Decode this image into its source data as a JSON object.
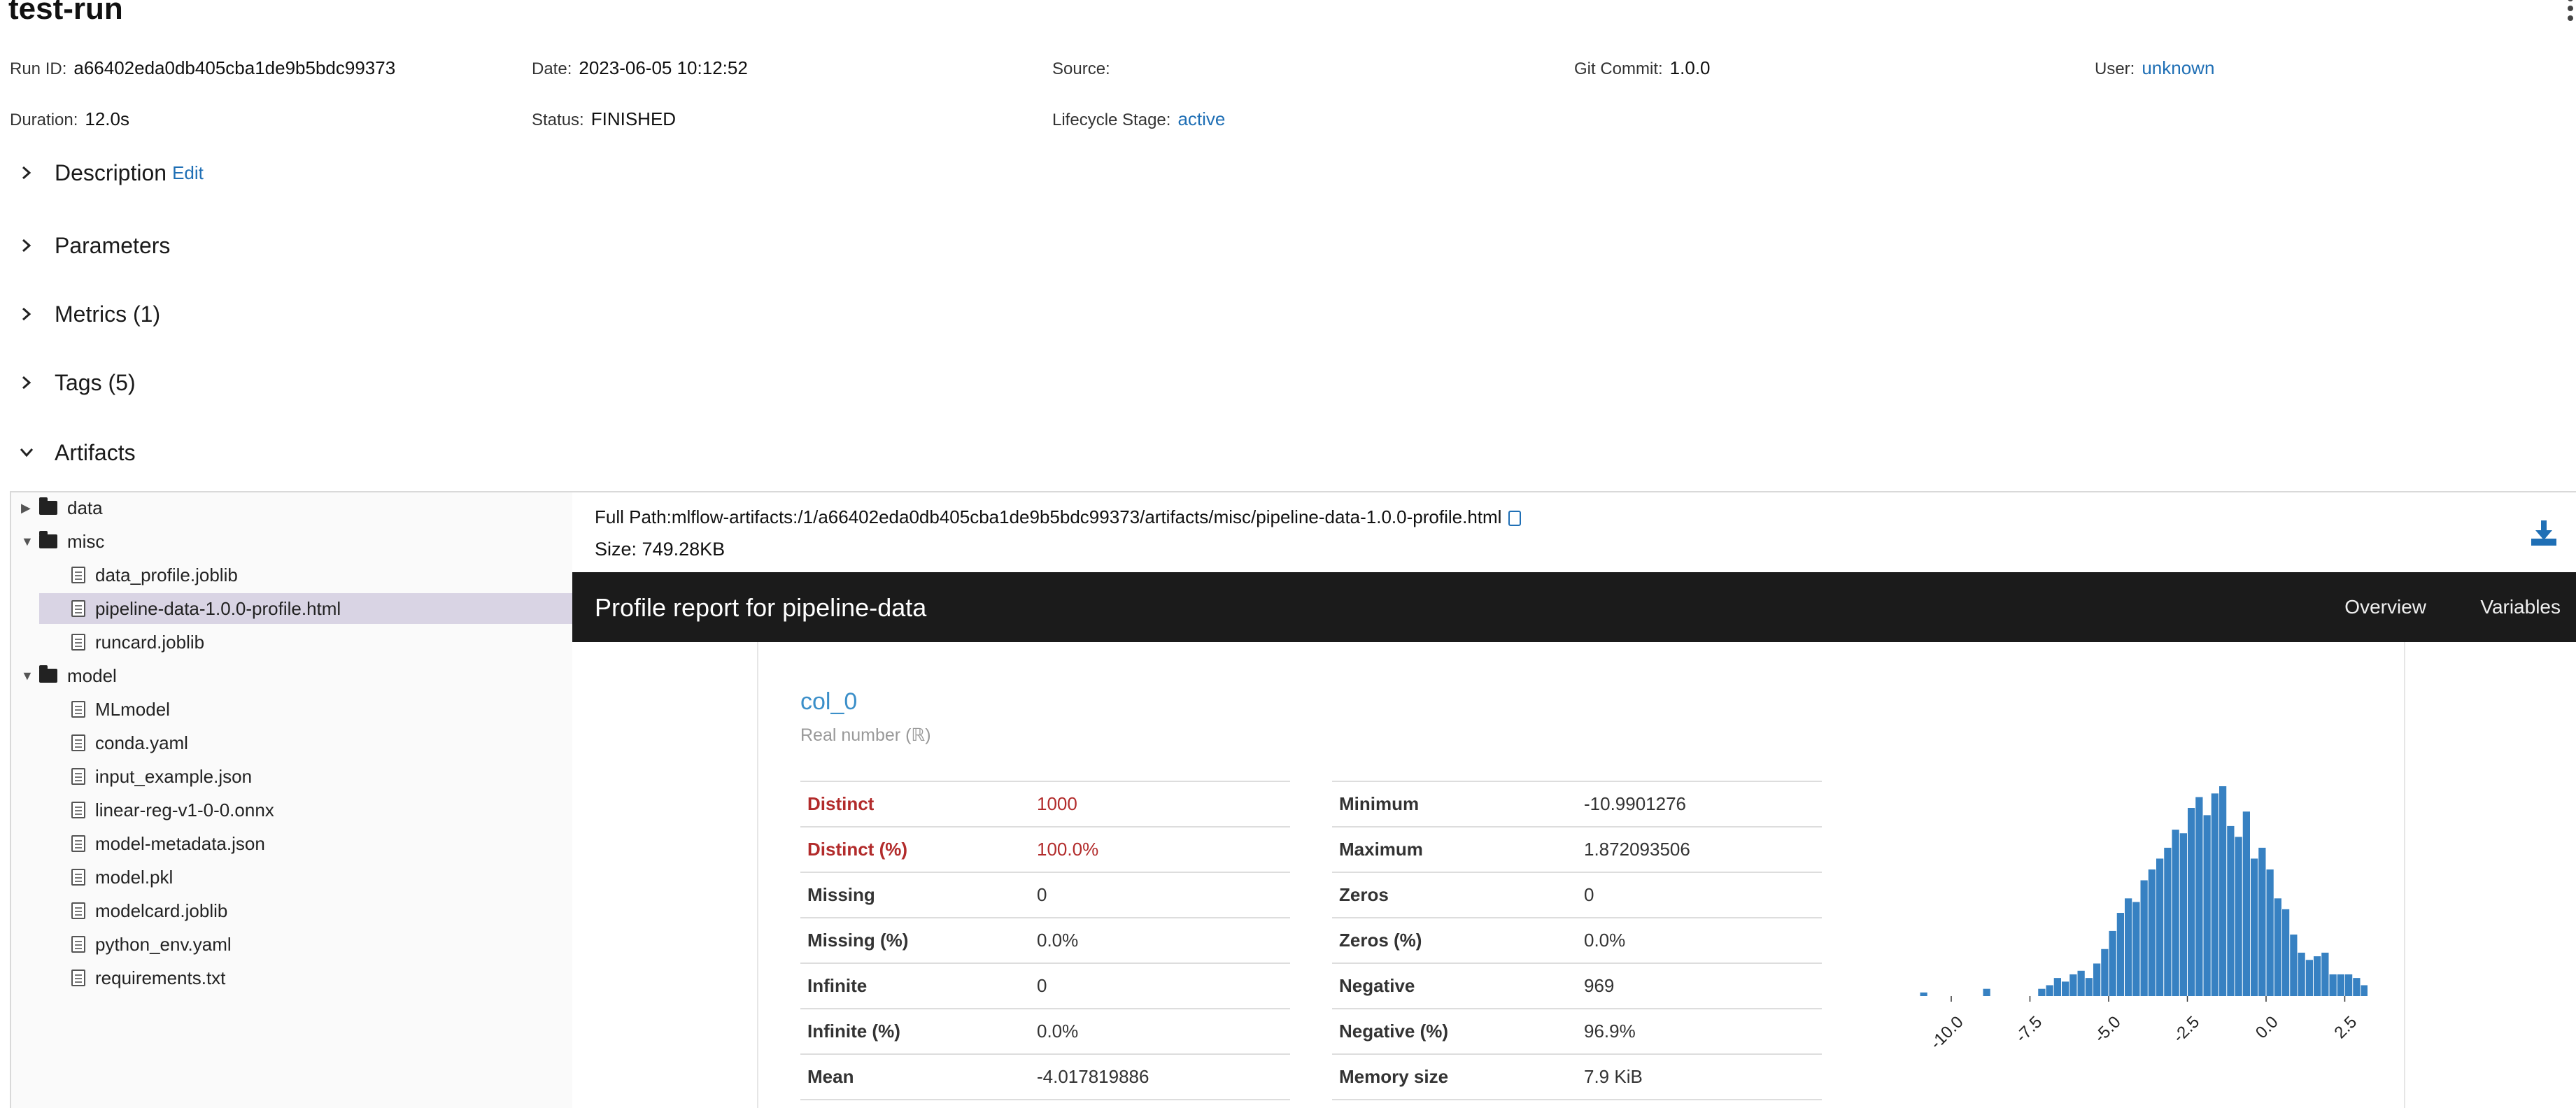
{
  "run": {
    "title": "test-run",
    "run_id_label": "Run ID:",
    "run_id": "a66402eda0db405cba1de9b5bdc99373",
    "date_label": "Date:",
    "date": "2023-06-05 10:12:52",
    "source_label": "Source:",
    "source": "",
    "git_label": "Git Commit:",
    "git": "1.0.0",
    "user_label": "User:",
    "user": "unknown",
    "duration_label": "Duration:",
    "duration": "12.0s",
    "status_label": "Status:",
    "status": "FINISHED",
    "lifecycle_label": "Lifecycle Stage:",
    "lifecycle": "active"
  },
  "sections": {
    "description": "Description",
    "edit": "Edit",
    "parameters": "Parameters",
    "metrics": "Metrics (1)",
    "tags": "Tags (5)",
    "artifacts": "Artifacts"
  },
  "tree": {
    "data": "data",
    "misc": "misc",
    "misc_items": [
      "data_profile.joblib",
      "pipeline-data-1.0.0-profile.html",
      "runcard.joblib"
    ],
    "model": "model",
    "model_items": [
      "MLmodel",
      "conda.yaml",
      "input_example.json",
      "linear-reg-v1-0-0.onnx",
      "model-metadata.json",
      "model.pkl",
      "modelcard.joblib",
      "python_env.yaml",
      "requirements.txt"
    ],
    "selected": "pipeline-data-1.0.0-profile.html"
  },
  "artifact": {
    "full_path": "Full Path:mlflow-artifacts:/1/a66402eda0db405cba1de9b5bdc99373/artifacts/misc/pipeline-data-1.0.0-profile.html",
    "size_label": "Size:",
    "size": "749.28KB"
  },
  "report": {
    "title": "Profile report for pipeline-data",
    "nav_overview": "Overview",
    "nav_variables": "Variables",
    "col_name": "col_0",
    "col_type": "Real number (ℝ)",
    "left_stats": [
      {
        "k": "Distinct",
        "v": "1000"
      },
      {
        "k": "Distinct (%)",
        "v": "100.0%"
      },
      {
        "k": "Missing",
        "v": "0"
      },
      {
        "k": "Missing (%)",
        "v": "0.0%"
      },
      {
        "k": "Infinite",
        "v": "0"
      },
      {
        "k": "Infinite (%)",
        "v": "0.0%"
      },
      {
        "k": "Mean",
        "v": "-4.017819886"
      }
    ],
    "right_stats": [
      {
        "k": "Minimum",
        "v": "-10.9901276"
      },
      {
        "k": "Maximum",
        "v": "1.872093506"
      },
      {
        "k": "Zeros",
        "v": "0"
      },
      {
        "k": "Zeros (%)",
        "v": "0.0%"
      },
      {
        "k": "Negative",
        "v": "969"
      },
      {
        "k": "Negative (%)",
        "v": "96.9%"
      },
      {
        "k": "Memory size",
        "v": "7.9 KiB"
      }
    ],
    "alert_color": "#b22b2b",
    "link_color": "#1f6fb5"
  },
  "chart_data": {
    "type": "bar",
    "title": "",
    "xlabel": "",
    "ylabel": "",
    "x_ticks": [
      "-10.0",
      "-7.5",
      "-5.0",
      "-2.5",
      "0.0",
      "2.5"
    ],
    "bin_start": -11.0,
    "bin_width": 0.25,
    "values": [
      1,
      0,
      0,
      0,
      0,
      0,
      0,
      0,
      2,
      0,
      0,
      0,
      0,
      0,
      0,
      2,
      3,
      5,
      4,
      6,
      7,
      5,
      9,
      13,
      18,
      23,
      27,
      26,
      32,
      35,
      38,
      41,
      46,
      45,
      52,
      55,
      50,
      56,
      58,
      47,
      44,
      51,
      38,
      41,
      35,
      27,
      24,
      17,
      12,
      10,
      11,
      12,
      6,
      6,
      6,
      5,
      3,
      2,
      3,
      3
    ],
    "bar_color": "#3781c2"
  }
}
